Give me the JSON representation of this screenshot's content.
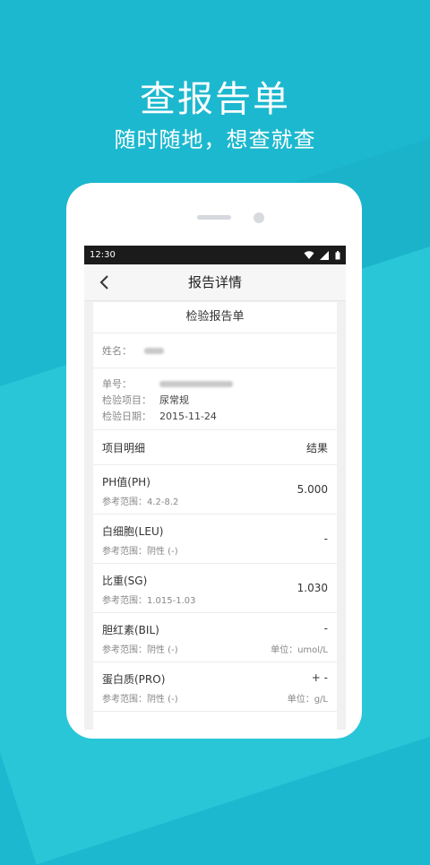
{
  "promo": {
    "title": "查报告单",
    "subtitle": "随时随地，想查就查"
  },
  "status_bar": {
    "time": "12:30"
  },
  "nav": {
    "title": "报告详情",
    "back_icon": "chevron-left-icon"
  },
  "report": {
    "title": "检验报告单",
    "name_label": "姓名：",
    "order_label": "单号：",
    "exam_label": "检验项目：",
    "exam_value": "尿常规",
    "date_label": "检验日期：",
    "date_value": "2015-11-24",
    "header_item": "项目明细",
    "header_result": "结果",
    "items": [
      {
        "name": "PH值(PH)",
        "range": "参考范围：4.2-8.2",
        "result": "5.000",
        "unit": ""
      },
      {
        "name": "白细胞(LEU)",
        "range": "参考范围：阴性 (-)",
        "result": "-",
        "unit": ""
      },
      {
        "name": "比重(SG)",
        "range": "参考范围：1.015-1.03",
        "result": "1.030",
        "unit": ""
      },
      {
        "name": "胆红素(BIL)",
        "range": "参考范围：阴性 (-)",
        "result": "-",
        "unit": "单位：umol/L"
      },
      {
        "name": "蛋白质(PRO)",
        "range": "参考范围：阴性 (-)",
        "result": "+ -",
        "unit": "单位：g/L"
      }
    ]
  },
  "colors": {
    "background": "#1cb8cf",
    "phone": "#ffffff",
    "status_bar": "#1b1b1b"
  }
}
